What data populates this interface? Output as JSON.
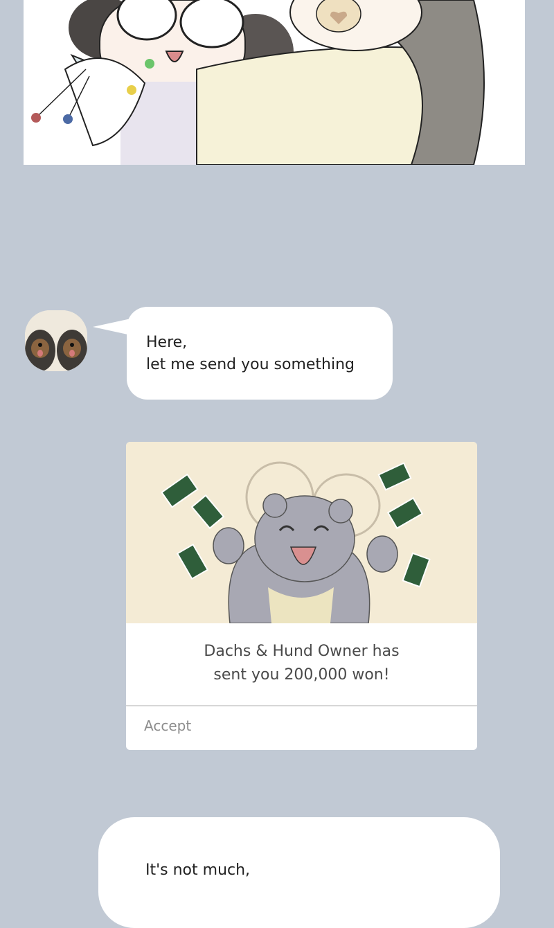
{
  "chat": {
    "avatar_icon": "dachshund-pair-avatar-icon",
    "message1": {
      "line1": "Here,",
      "line2": "let me send you something"
    },
    "transfer": {
      "illustration_icon": "happy-mouse-money-icon",
      "message_line1": "Dachs & Hund Owner has",
      "message_line2": "sent you 200,000 won!",
      "accept_label": "Accept"
    },
    "message2": {
      "line1": "It's not much,"
    }
  },
  "colors": {
    "background": "#c1c9d4",
    "bubble": "#ffffff",
    "card_banner": "#f4ebd5",
    "money_green": "#2f5e3a"
  }
}
